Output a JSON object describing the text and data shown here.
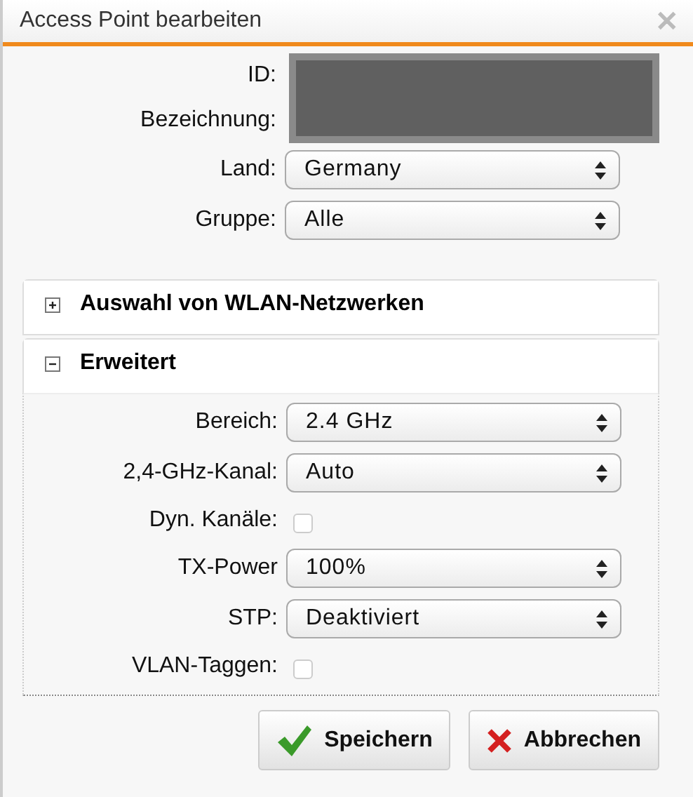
{
  "window": {
    "title": "Access Point bearbeiten",
    "close": "✕"
  },
  "fields": [
    {
      "kind": "redacted",
      "labels": [
        "ID:",
        "Bezeichnung:"
      ]
    },
    {
      "kind": "select",
      "label": "Land:",
      "value": "Germany"
    },
    {
      "kind": "select",
      "label": "Gruppe:",
      "value": "Alle"
    }
  ],
  "sections": [
    {
      "title": "Auswahl von WLAN-Netzwerken",
      "expanded": false
    },
    {
      "title": "Erweitert",
      "expanded": true,
      "fields": [
        {
          "kind": "select",
          "label": "Bereich:",
          "value": "2.4 GHz"
        },
        {
          "kind": "select",
          "label": "2,4-GHz-Kanal:",
          "value": "Auto"
        },
        {
          "kind": "checkbox",
          "label": "Dyn. Kanäle:",
          "checked": false
        },
        {
          "kind": "select",
          "label": "TX-Power",
          "value": "100%"
        },
        {
          "kind": "select",
          "label": "STP:",
          "value": "Deaktiviert"
        },
        {
          "kind": "checkbox",
          "label": "VLAN-Taggen:",
          "checked": false
        }
      ]
    }
  ],
  "buttons": [
    {
      "kind": "save",
      "label": "Speichern"
    },
    {
      "kind": "cancel",
      "label": "Abbrechen"
    }
  ]
}
